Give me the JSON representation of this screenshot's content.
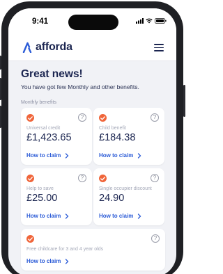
{
  "status_bar": {
    "time": "9:41"
  },
  "app": {
    "logo_text": "afforda"
  },
  "page": {
    "headline": "Great news!",
    "subline": "You have got few Monthly and other benefits.",
    "section_label": "Monthly benefits"
  },
  "benefits": [
    {
      "label": "Universal credit",
      "amount": "£1,423.65",
      "cta": "How to claim"
    },
    {
      "label": "Child benefit",
      "amount": "£184.38",
      "cta": "How to claim"
    },
    {
      "label": "Help to save",
      "amount": "£25.00",
      "cta": "How to claim"
    },
    {
      "label": "Single occupier discount",
      "amount": "24.90",
      "cta": "How to claim"
    },
    {
      "label": "Free childcare for 3 and 4 year olds",
      "cta": "How to claim"
    }
  ],
  "colors": {
    "brand": "#1b2550",
    "accent": "#f0653a",
    "link": "#2b5bd7",
    "logo_mark": "#2b5bd7"
  },
  "icons": [
    "signal-icon",
    "wifi-icon",
    "battery-icon",
    "logo-mark-icon",
    "menu-icon",
    "check-icon",
    "help-icon",
    "chevron-right-icon"
  ]
}
